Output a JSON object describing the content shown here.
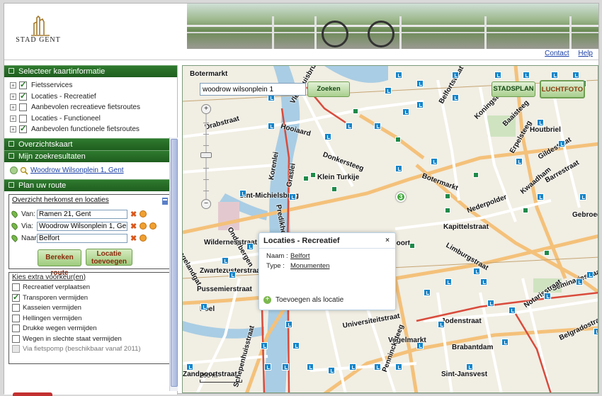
{
  "header": {
    "logo_text": "STAD  GENT",
    "links": {
      "contact": "Contact",
      "help": "Help"
    }
  },
  "sidebar": {
    "sections": {
      "layers_title": "Selecteer kaartinformatie",
      "overview_title": "Overzichtskaart",
      "results_title": "Mijn zoekresultaten",
      "route_title": "Plan uw route"
    },
    "layers": [
      {
        "label": "Fietsservices",
        "checked": true
      },
      {
        "label": "Locaties - Recreatief",
        "checked": true
      },
      {
        "label": "Aanbevolen recreatieve fietsroutes",
        "checked": false
      },
      {
        "label": "Locaties - Functioneel",
        "checked": false
      },
      {
        "label": "Aanbevolen functionele fietsroutes",
        "checked": true
      }
    ],
    "search_result": "Woodrow Wilsonplein 1, Gent",
    "route": {
      "box_title": "Overzicht herkomst en locaties",
      "from_label": "Van:",
      "from_value": "Ramen 21, Gent",
      "via_label": "Via:",
      "via_value": "Woodrow Wilsonplein 1, Gent",
      "to_label": "Naar:",
      "to_value": "Belfort",
      "calc_button": "Bereken route",
      "add_button": "Locatie toevoegen"
    },
    "preferences": {
      "title": "Kies extra voorkeur(en)",
      "items": [
        {
          "label": "Recreatief verplaatsen",
          "checked": false,
          "enabled": true
        },
        {
          "label": "Transporen vermijden",
          "checked": true,
          "enabled": true
        },
        {
          "label": "Kasseien vermijden",
          "checked": false,
          "enabled": true
        },
        {
          "label": "Hellingen vermijden",
          "checked": false,
          "enabled": true
        },
        {
          "label": "Drukke wegen vermijden",
          "checked": false,
          "enabled": true
        },
        {
          "label": "Wegen in slechte staat vermijden",
          "checked": false,
          "enabled": true
        },
        {
          "label": "Via fietspomp (beschikbaar vanaf 2011)",
          "checked": false,
          "enabled": false
        }
      ]
    }
  },
  "map": {
    "search_value": "woodrow wilsonplein 1",
    "search_button": "Zoeken",
    "view_buttons": {
      "stadsplan": "STADSPLAN",
      "luchtfoto": "LUCHTFOTO"
    },
    "marker_number": "3",
    "scale_text": "200 m",
    "streets": [
      "Botermarkt",
      "Vleeshuisbrug",
      "Drabstraat",
      "Hooiaard",
      "Korenlei",
      "Graslei",
      "Donkersteeg",
      "Klein Turkije",
      "Sint-Michielsbrug",
      "Predikherenlei",
      "Onderbergen",
      "Wildernesstraat",
      "Ingelandgat",
      "Zwartezusterstraat",
      "Pussemierstraat",
      "Poel",
      "Koningstraat",
      "Baaisteeg",
      "Houtbriel",
      "Erpelsteeg",
      "Kwaadham",
      "Gildestraat",
      "Barrestraat",
      "Nederpolder",
      "Gebroedersvan",
      "Kapittelstraat",
      "Limburgstraat",
      "Botermarkt",
      "Seminariestraat",
      "Hoogpoort",
      "Belfortstraat",
      "Jodenstraat",
      "Universiteitstraat",
      "Notarisstraat",
      "Vogelmarkt",
      "Brabantdam",
      "Belgradostraat",
      "Zandpoortstraat",
      "Sint-Jansvest",
      "Schepenhuisstraat",
      "Pennincksteeg"
    ],
    "popup": {
      "title": "Locaties - Recreatief",
      "close": "×",
      "name_key": "Naam :",
      "name_value": "Belfort",
      "type_key": "Type :",
      "type_value": "Monumenten",
      "add_location": "Toevoegen als locatie"
    }
  }
}
